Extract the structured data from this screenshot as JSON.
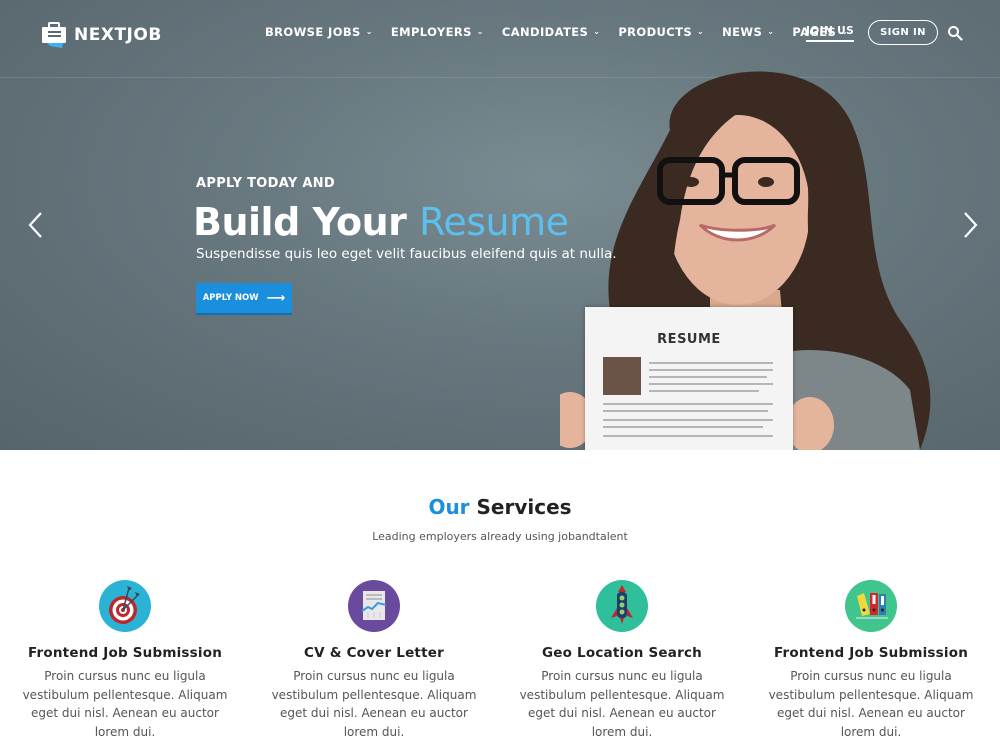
{
  "header": {
    "logo_text": "NEXTJOB",
    "nav": [
      {
        "label": "BROWSE JOBS",
        "has_dropdown": true
      },
      {
        "label": "EMPLOYERS",
        "has_dropdown": true
      },
      {
        "label": "CANDIDATES",
        "has_dropdown": true
      },
      {
        "label": "PRODUCTS",
        "has_dropdown": true
      },
      {
        "label": "NEWS",
        "has_dropdown": true
      },
      {
        "label": "PAGES",
        "has_dropdown": true
      }
    ],
    "join_us_label": "JOIN US",
    "sign_in_label": "SIGN IN",
    "search_icon": "search-icon",
    "dropdown_glyph": "⌄"
  },
  "hero": {
    "kicker": "APPLY TODAY AND",
    "title_main": "Build Your ",
    "title_accent": "Resume",
    "subtitle": "Suspendisse quis leo eget velit faucibus eleifend quis at nulla.",
    "cta_label": "APPLY NOW",
    "cta_arrow": "⟶",
    "resume_paper_title": "RESUME",
    "prev_icon": "chevron-left-icon",
    "next_icon": "chevron-right-icon"
  },
  "services": {
    "title_accent": "Our",
    "title_main": " Services",
    "subtitle": "Leading employers already using jobandtalent",
    "items": [
      {
        "icon": "target-icon",
        "color": "#2bb3d6",
        "title": "Frontend Job Submission",
        "desc": "Proin cursus nunc eu ligula vestibulum pellentesque. Aliquam eget dui nisl. Aenean eu auctor lorem dui."
      },
      {
        "icon": "document-chart-icon",
        "color": "#6a4a9c",
        "title": "CV & Cover Letter",
        "desc": "Proin cursus nunc eu ligula vestibulum pellentesque. Aliquam eget dui nisl. Aenean eu auctor lorem dui."
      },
      {
        "icon": "rocket-icon",
        "color": "#2fbf9b",
        "title": "Geo Location Search",
        "desc": "Proin cursus nunc eu ligula vestibulum pellentesque. Aliquam eget dui nisl. Aenean eu auctor lorem dui."
      },
      {
        "icon": "binders-icon",
        "color": "#3fc58d",
        "title": "Frontend Job Submission",
        "desc": "Proin cursus nunc eu ligula vestibulum pellentesque. Aliquam eget dui nisl. Aenean eu auctor lorem dui."
      }
    ]
  },
  "colors": {
    "accent": "#1a8fde",
    "hero_accent": "#5bc0ee"
  }
}
